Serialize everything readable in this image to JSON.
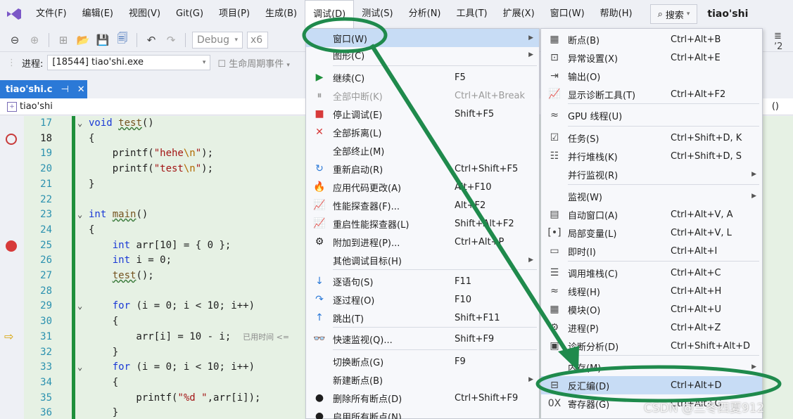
{
  "menubar": {
    "items": [
      "文件(F)",
      "编辑(E)",
      "视图(V)",
      "Git(G)",
      "项目(P)",
      "生成(B)",
      "调试(D)",
      "测试(S)",
      "分析(N)",
      "工具(T)",
      "扩展(X)",
      "窗口(W)",
      "帮助(H)"
    ],
    "search_label": "搜索",
    "title": "tiao'shi"
  },
  "toolbar": {
    "config": "Debug",
    "platform": "x6"
  },
  "process_bar": {
    "label": "进程:",
    "value": "[18544] tiao'shi.exe",
    "lifecycle": "生命周期事件"
  },
  "tab": {
    "name": "tiao'shi.c",
    "pin": "⊣",
    "close": "✕"
  },
  "navbar": {
    "scope": "tiao'shi",
    "right": "()"
  },
  "code_lines": [
    {
      "n": "17",
      "text": "void test()"
    },
    {
      "n": "18",
      "text": "{"
    },
    {
      "n": "19",
      "text": "    printf(\"hehe\\n\");"
    },
    {
      "n": "20",
      "text": "    printf(\"test\\n\");"
    },
    {
      "n": "21",
      "text": "}"
    },
    {
      "n": "22",
      "text": ""
    },
    {
      "n": "23",
      "text": "int main()"
    },
    {
      "n": "24",
      "text": "{"
    },
    {
      "n": "25",
      "text": "    int arr[10] = { 0 };"
    },
    {
      "n": "26",
      "text": "    int i = 0;"
    },
    {
      "n": "27",
      "text": "    test();"
    },
    {
      "n": "28",
      "text": ""
    },
    {
      "n": "29",
      "text": "    for (i = 0; i < 10; i++)"
    },
    {
      "n": "30",
      "text": "    {"
    },
    {
      "n": "31",
      "text": "        arr[i] = 10 - i;"
    },
    {
      "n": "32",
      "text": "    }"
    },
    {
      "n": "33",
      "text": "    for (i = 0; i < 10; i++)"
    },
    {
      "n": "34",
      "text": "    {"
    },
    {
      "n": "35",
      "text": "        printf(\"%d \",arr[i]);"
    },
    {
      "n": "36",
      "text": "    }"
    }
  ],
  "elapsed_hint": "已用时间 <=",
  "debug_menu": [
    {
      "label": "窗口(W)",
      "shortcut": "",
      "icon": "",
      "submenu": true,
      "highlight": true
    },
    {
      "label": "图形(C)",
      "shortcut": "",
      "icon": "",
      "submenu": true
    },
    {
      "label": "继续(C)",
      "shortcut": "F5",
      "icon": "▶"
    },
    {
      "label": "全部中断(K)",
      "shortcut": "Ctrl+Alt+Break",
      "icon": "⏸",
      "disabled": true
    },
    {
      "label": "停止调试(E)",
      "shortcut": "Shift+F5",
      "icon": "■"
    },
    {
      "label": "全部拆离(L)",
      "shortcut": "",
      "icon": "✕"
    },
    {
      "label": "全部终止(M)",
      "shortcut": "",
      "icon": ""
    },
    {
      "label": "重新启动(R)",
      "shortcut": "Ctrl+Shift+F5",
      "icon": "↻"
    },
    {
      "label": "应用代码更改(A)",
      "shortcut": "Alt+F10",
      "icon": "🔥"
    },
    {
      "label": "性能探查器(F)...",
      "shortcut": "Alt+F2",
      "icon": "📈"
    },
    {
      "label": "重启性能探查器(L)",
      "shortcut": "Shift+Alt+F2",
      "icon": "📈"
    },
    {
      "label": "附加到进程(P)...",
      "shortcut": "Ctrl+Alt+P",
      "icon": "⚙"
    },
    {
      "label": "其他调试目标(H)",
      "shortcut": "",
      "icon": "",
      "submenu": true
    },
    {
      "label": "逐语句(S)",
      "shortcut": "F11",
      "icon": "↓"
    },
    {
      "label": "逐过程(O)",
      "shortcut": "F10",
      "icon": "↷"
    },
    {
      "label": "跳出(T)",
      "shortcut": "Shift+F11",
      "icon": "↑"
    },
    {
      "label": "快速监视(Q)...",
      "shortcut": "Shift+F9",
      "icon": "👓"
    },
    {
      "label": "切换断点(G)",
      "shortcut": "F9",
      "icon": ""
    },
    {
      "label": "新建断点(B)",
      "shortcut": "",
      "icon": "",
      "submenu": true
    },
    {
      "label": "删除所有断点(D)",
      "shortcut": "Ctrl+Shift+F9",
      "icon": "●"
    },
    {
      "label": "启用所有断点(N)",
      "shortcut": "",
      "icon": "●"
    }
  ],
  "window_menu": [
    {
      "label": "断点(B)",
      "shortcut": "Ctrl+Alt+B",
      "icon": "▦"
    },
    {
      "label": "异常设置(X)",
      "shortcut": "Ctrl+Alt+E",
      "icon": "⊡"
    },
    {
      "label": "输出(O)",
      "shortcut": "",
      "icon": "⇥"
    },
    {
      "label": "显示诊断工具(T)",
      "shortcut": "Ctrl+Alt+F2",
      "icon": "📈"
    },
    {
      "label": "GPU 线程(U)",
      "shortcut": "",
      "icon": "≈"
    },
    {
      "label": "任务(S)",
      "shortcut": "Ctrl+Shift+D, K",
      "icon": "☑"
    },
    {
      "label": "并行堆栈(K)",
      "shortcut": "Ctrl+Shift+D, S",
      "icon": "☷"
    },
    {
      "label": "并行监视(R)",
      "shortcut": "",
      "icon": "",
      "submenu": true
    },
    {
      "label": "监视(W)",
      "shortcut": "",
      "icon": "",
      "submenu": true
    },
    {
      "label": "自动窗口(A)",
      "shortcut": "Ctrl+Alt+V, A",
      "icon": "▤"
    },
    {
      "label": "局部变量(L)",
      "shortcut": "Ctrl+Alt+V, L",
      "icon": "[•]"
    },
    {
      "label": "即时(I)",
      "shortcut": "Ctrl+Alt+I",
      "icon": "▭"
    },
    {
      "label": "调用堆栈(C)",
      "shortcut": "Ctrl+Alt+C",
      "icon": "☰"
    },
    {
      "label": "线程(H)",
      "shortcut": "Ctrl+Alt+H",
      "icon": "≈"
    },
    {
      "label": "模块(O)",
      "shortcut": "Ctrl+Alt+U",
      "icon": "▦"
    },
    {
      "label": "进程(P)",
      "shortcut": "Ctrl+Alt+Z",
      "icon": "⚙"
    },
    {
      "label": "诊断分析(D)",
      "shortcut": "Ctrl+Shift+Alt+D",
      "icon": "▣"
    },
    {
      "label": "内存(M)",
      "shortcut": "",
      "icon": "",
      "submenu": true
    },
    {
      "label": "反汇编(D)",
      "shortcut": "Ctrl+Alt+D",
      "icon": "⊟",
      "highlight": true
    },
    {
      "label": "寄存器(G)",
      "shortcut": "Ctrl+Alt+G",
      "icon": "0X"
    }
  ],
  "watermark": "CSDN @三冬四夏912",
  "colors": {
    "annotation_green": "#1f8a4c",
    "highlight_blue": "#c7dcf5",
    "tab_blue": "#2b79d7",
    "breakpoint_red": "#d73a3a",
    "code_background": "#e6f1e4"
  }
}
